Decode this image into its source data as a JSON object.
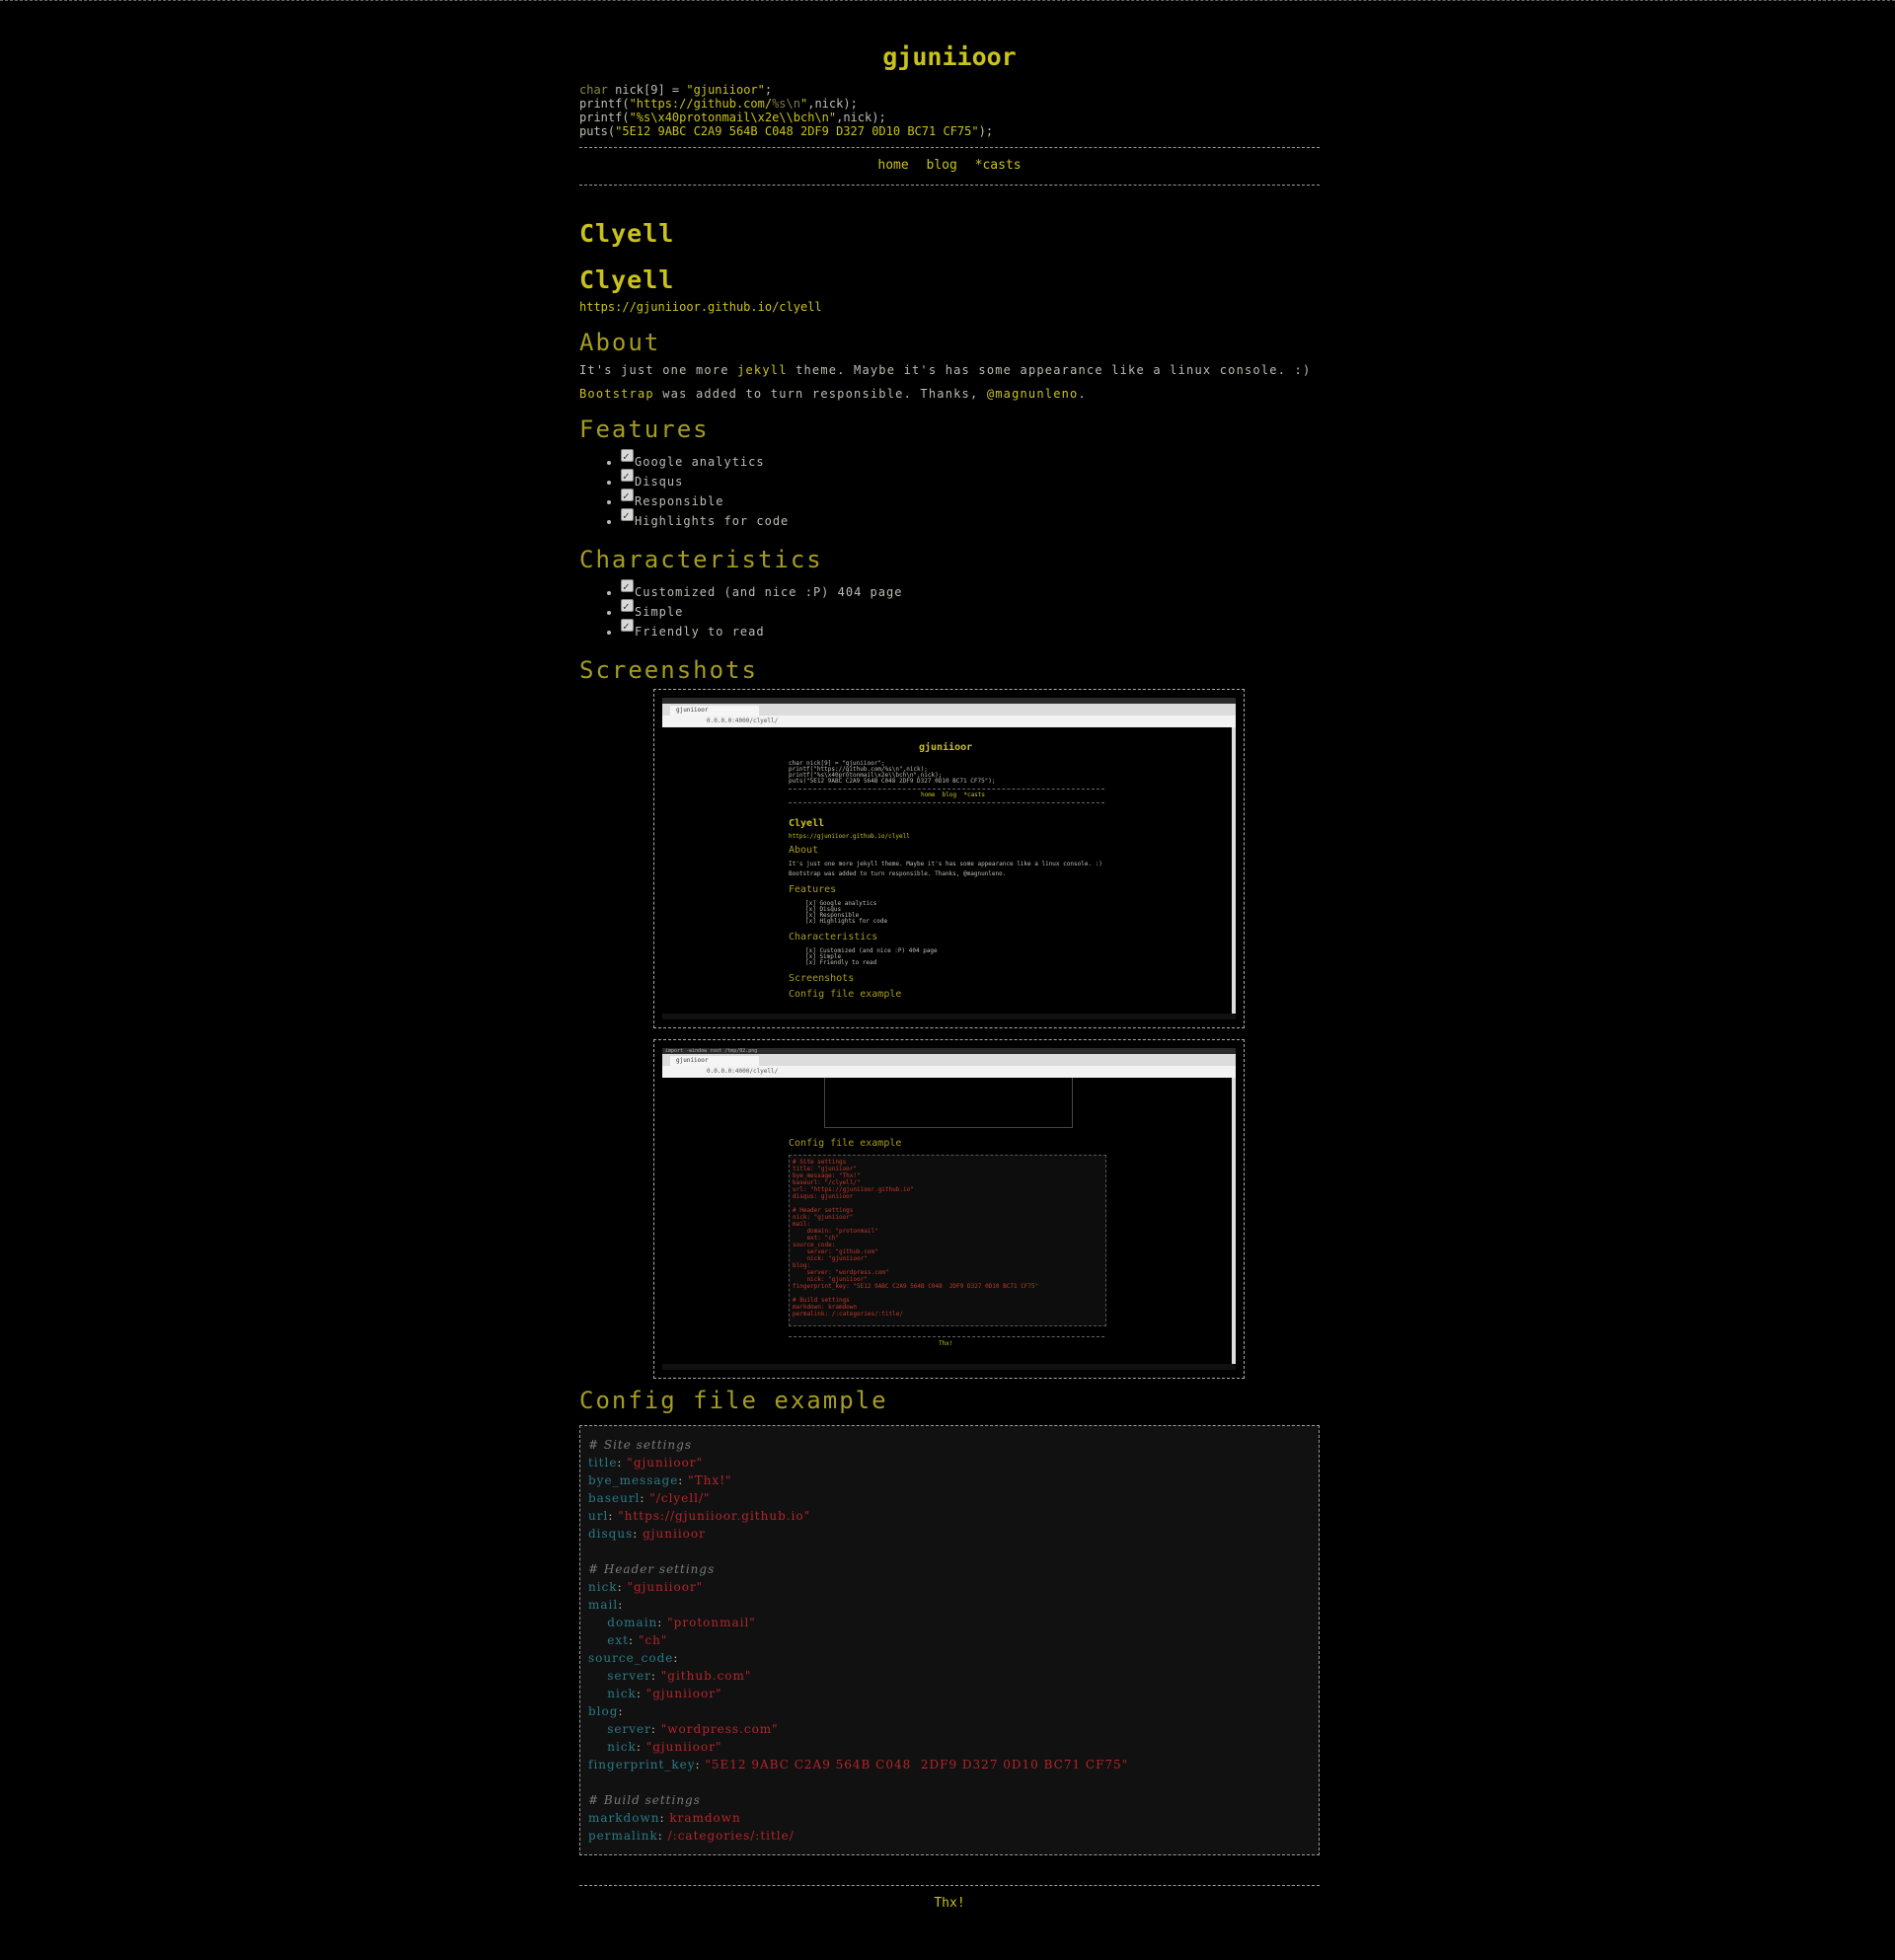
{
  "site": {
    "title": "gjuniioor",
    "code_lines": [
      {
        "kw": "char",
        "rest": " nick[9] = ",
        "str": "\"gjuniioor\"",
        "end": ";"
      },
      {
        "pre": "printf(",
        "str": "\"https://github.com/",
        "dim": "%s\\n",
        "str2": "\"",
        "end": ",nick);"
      },
      {
        "pre": "printf(",
        "str": "\"%s\\x40protonmail\\x2e\\\\bch\\n\"",
        "end": ",nick);"
      },
      {
        "pre": "puts(",
        "str": "\"5E12 9ABC C2A9 564B C048 2DF9 D327 0D10 BC71 CF75\"",
        "end": ");"
      }
    ]
  },
  "nav": {
    "home": "home",
    "blog": "blog",
    "casts": "*casts"
  },
  "post": {
    "title": "Clyell",
    "heading": "Clyell",
    "url": "https://gjuniioor.github.io/clyell",
    "about": {
      "heading": "About",
      "p1_a": "It's just one more ",
      "p1_link": "jekyll",
      "p1_b": " theme. Maybe it's has some appearance like a linux console. :)",
      "p2_link": "Bootstrap",
      "p2_a": " was added to turn responsible. Thanks, ",
      "p2_link2": "@magnunleno",
      "p2_b": "."
    },
    "features": {
      "heading": "Features",
      "items": [
        "Google analytics",
        "Disqus",
        "Responsible",
        "Highlights for code"
      ]
    },
    "characteristics": {
      "heading": "Characteristics",
      "items": [
        "Customized (and nice :P) 404 page",
        "Simple",
        "Friendly to read"
      ]
    },
    "screenshots": {
      "heading": "Screenshots",
      "shot1": {
        "tab": "gjuniioor",
        "url": "0.0.0.0:4000/clyell/",
        "title": "gjuniioor",
        "lines": [
          "char nick[9] = \"gjuniioor\";",
          "printf(\"https://github.com/%s\\n\",nick);",
          "printf(\"%s\\x40protonmail\\x2e\\\\bch\\n\",nick);",
          "puts(\"5E12 9ABC C2A9 564B C048 2DF9 D327 0D10 BC71 CF75\");"
        ],
        "nav": "home  blog  *casts",
        "h1": "Clyell",
        "link": "https://gjuniioor.github.io/clyell",
        "about": "About",
        "about_p1": "It's just one more jekyll theme. Maybe it's has some appearance like a linux console. :)",
        "about_p2": "Bootstrap was added to turn responsible. Thanks, @magnunleno.",
        "features": "Features",
        "feat_items": [
          "[x] Google analytics",
          "[x] Disqus",
          "[x] Responsible",
          "[x] Highlights for code"
        ],
        "chars": "Characteristics",
        "char_items": [
          "[x] Customized (and nice :P) 404 page",
          "[x] Simple",
          "[x] Friendly to read"
        ],
        "screens": "Screenshots",
        "config": "Config file example"
      },
      "shot2": {
        "cmd": "import -window root /tmp/02.png",
        "tab": "gjuniioor",
        "url": "0.0.0.0:4000/clyell/",
        "config": "Config file example",
        "code": [
          "# Site settings",
          "title: \"gjuniioor\"",
          "bye_message: \"Thx!\"",
          "baseurl: \"/clyell/\"",
          "url: \"https://gjuniioor.github.io\"",
          "disqus: gjuniioor",
          "",
          "# Header settings",
          "nick: \"gjuniioor\"",
          "mail:",
          "    domain: \"protonmail\"",
          "    ext: \"ch\"",
          "source_code:",
          "    server: \"github.com\"",
          "    nick: \"gjuniioor\"",
          "blog:",
          "    server: \"wordpress.com\"",
          "    nick: \"gjuniioor\"",
          "fingerprint_key: \"5E12 9ABC C2A9 564B C048  2DF9 D327 0D10 BC71 CF75\"",
          "",
          "# Build settings",
          "markdown: kramdown",
          "permalink: /:categories/:title/"
        ],
        "thx": "Thx!"
      }
    },
    "config": {
      "heading": "Config file example",
      "lines": [
        {
          "type": "comment",
          "text": "# Site settings"
        },
        {
          "type": "kv",
          "key": "title",
          "val": "\"gjuniioor\""
        },
        {
          "type": "kv",
          "key": "bye_message",
          "val": "\"Thx!\""
        },
        {
          "type": "kv",
          "key": "baseurl",
          "val": "\"/clyell/\""
        },
        {
          "type": "kv",
          "key": "url",
          "val": "\"https://gjuniioor.github.io\""
        },
        {
          "type": "kv",
          "key": "disqus",
          "val": "gjuniioor"
        },
        {
          "type": "blank"
        },
        {
          "type": "comment",
          "text": "# Header settings"
        },
        {
          "type": "kv",
          "key": "nick",
          "val": "\"gjuniioor\""
        },
        {
          "type": "key",
          "key": "mail"
        },
        {
          "type": "kv",
          "indent": true,
          "key": "domain",
          "val": "\"protonmail\""
        },
        {
          "type": "kv",
          "indent": true,
          "key": "ext",
          "val": "\"ch\""
        },
        {
          "type": "key",
          "key": "source_code"
        },
        {
          "type": "kv",
          "indent": true,
          "key": "server",
          "val": "\"github.com\""
        },
        {
          "type": "kv",
          "indent": true,
          "key": "nick",
          "val": "\"gjuniioor\""
        },
        {
          "type": "key",
          "key": "blog"
        },
        {
          "type": "kv",
          "indent": true,
          "key": "server",
          "val": "\"wordpress.com\""
        },
        {
          "type": "kv",
          "indent": true,
          "key": "nick",
          "val": "\"gjuniioor\""
        },
        {
          "type": "kv",
          "key": "fingerprint_key",
          "val": "\"5E12 9ABC C2A9 564B C048  2DF9 D327 0D10 BC71 CF75\""
        },
        {
          "type": "blank"
        },
        {
          "type": "comment",
          "text": "# Build settings"
        },
        {
          "type": "kv",
          "key": "markdown",
          "val": "kramdown"
        },
        {
          "type": "kv",
          "key": "permalink",
          "val": "/:categories/:title/"
        }
      ]
    }
  },
  "footer": {
    "text": "Thx!"
  }
}
